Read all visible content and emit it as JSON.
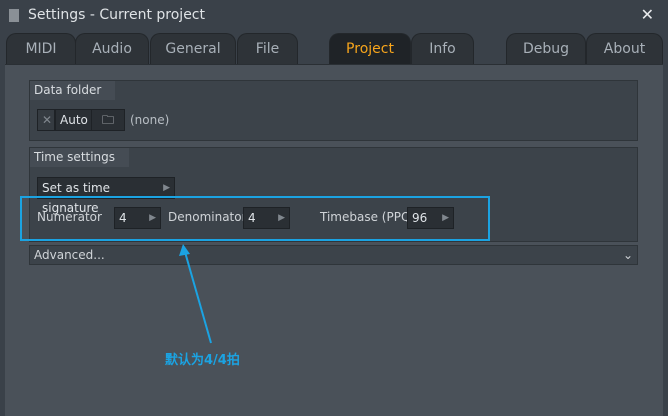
{
  "window": {
    "title": "Settings - Current project",
    "close_icon": "close-icon"
  },
  "tabs": [
    {
      "label": "MIDI"
    },
    {
      "label": "Audio"
    },
    {
      "label": "General"
    },
    {
      "label": "File"
    },
    {
      "label": "Project",
      "active": true
    },
    {
      "label": "Info"
    },
    {
      "label": "Debug"
    },
    {
      "label": "About"
    }
  ],
  "data_folder": {
    "title": "Data folder",
    "auto_label": "Auto",
    "value": "(none)"
  },
  "time_settings": {
    "title": "Time settings",
    "set_button": "Set as time signature",
    "numerator_label": "Numerator",
    "numerator": "4",
    "denominator_label": "Denominator",
    "denominator": "4",
    "timebase_label": "Timebase (PPQ)",
    "timebase": "96"
  },
  "advanced": {
    "label": "Advanced..."
  },
  "annotation": {
    "text": "默认为4/4拍",
    "color": "#1ba3e2"
  }
}
